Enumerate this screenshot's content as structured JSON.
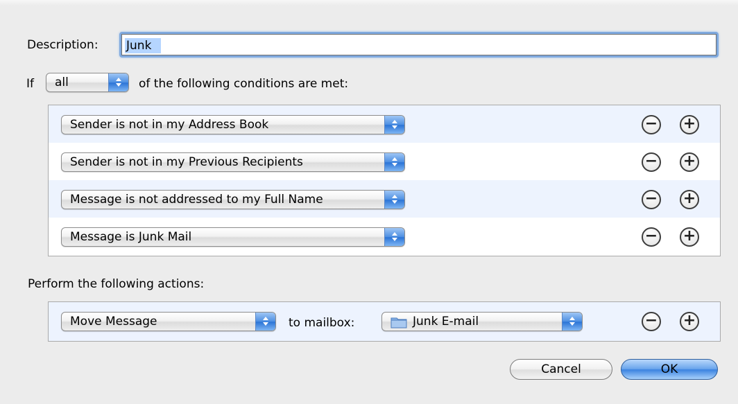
{
  "description": {
    "label": "Description:",
    "value": "Junk"
  },
  "condition_header": {
    "if_label": "If",
    "quantifier": "all",
    "suffix": "of the following conditions are met:"
  },
  "conditions": [
    {
      "label": "Sender is not in my Address Book"
    },
    {
      "label": "Sender is not in my Previous Recipients"
    },
    {
      "label": "Message is not addressed to my Full Name"
    },
    {
      "label": "Message is Junk Mail"
    }
  ],
  "actions": {
    "label": "Perform the following actions:",
    "action": "Move Message",
    "to_label": "to mailbox:",
    "mailbox": "Junk E-mail"
  },
  "buttons": {
    "remove_glyph": "−",
    "add_glyph": "+",
    "cancel": "Cancel",
    "ok": "OK"
  },
  "colors": {
    "accent": "#4d8fe2",
    "focus_ring": "#7fa9de",
    "alt_row": "#edf3fe"
  }
}
